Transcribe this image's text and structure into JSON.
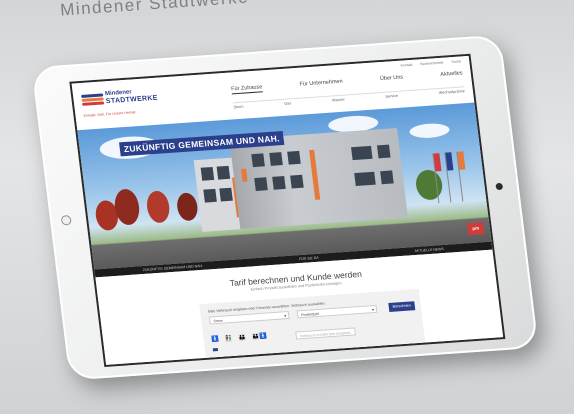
{
  "caption": "Mindener Stadtwerke",
  "brand": {
    "name1": "Mindener",
    "name2": "STADTWERKE",
    "tagline": "Energie. Nah. Für Unsere Heimat",
    "colors": {
      "blue": "#2b3f8c",
      "red": "#d33b3b",
      "orange": "#e57a3a",
      "dark_strip": "#1c1c1c"
    }
  },
  "top_links": [
    "Kontakt",
    "Barrierefreiheit",
    "Suche"
  ],
  "main_nav": [
    {
      "label": "Für Zuhause",
      "active": true
    },
    {
      "label": "Für Unternehmen",
      "active": false
    },
    {
      "label": "Über Uns",
      "active": false
    },
    {
      "label": "Aktuelles",
      "active": false
    }
  ],
  "sub_nav": [
    "Strom",
    "Gas",
    "Wasser",
    "Service",
    "Wechselprämie"
  ],
  "hero": {
    "headline": "ZUKÜNFTIG GEMEINSAM UND NAH.",
    "partner_logo": "pm"
  },
  "tab_strip": [
    "ZUKÜNFTIG GEMEINSAM UND NAH.",
    "FÜR SIE DA",
    "AKTUELLE NEWS"
  ],
  "tariff": {
    "heading": "Tarif berechnen und Kunde werden",
    "subtitle": "Einfach Produkt auswählen und Postleitzahl eintragen.",
    "instruction": "Bitte Verbrauch eingeben oder Personen auswählen. Verbrauch auswählen:",
    "product_select": "Strom",
    "postcode_select": "Postleitzahl",
    "submit_label": "Berechnen",
    "consumption_placeholder": "Verbrauch in kWh/Jahr eingeben",
    "person_options": [
      "1 Person",
      "2 Personen",
      "3 Personen",
      "4 Personen"
    ],
    "selected_persons": 1
  },
  "icons": [
    "person-icon",
    "chevron-down-icon",
    "camera-icon",
    "home-button-icon"
  ]
}
